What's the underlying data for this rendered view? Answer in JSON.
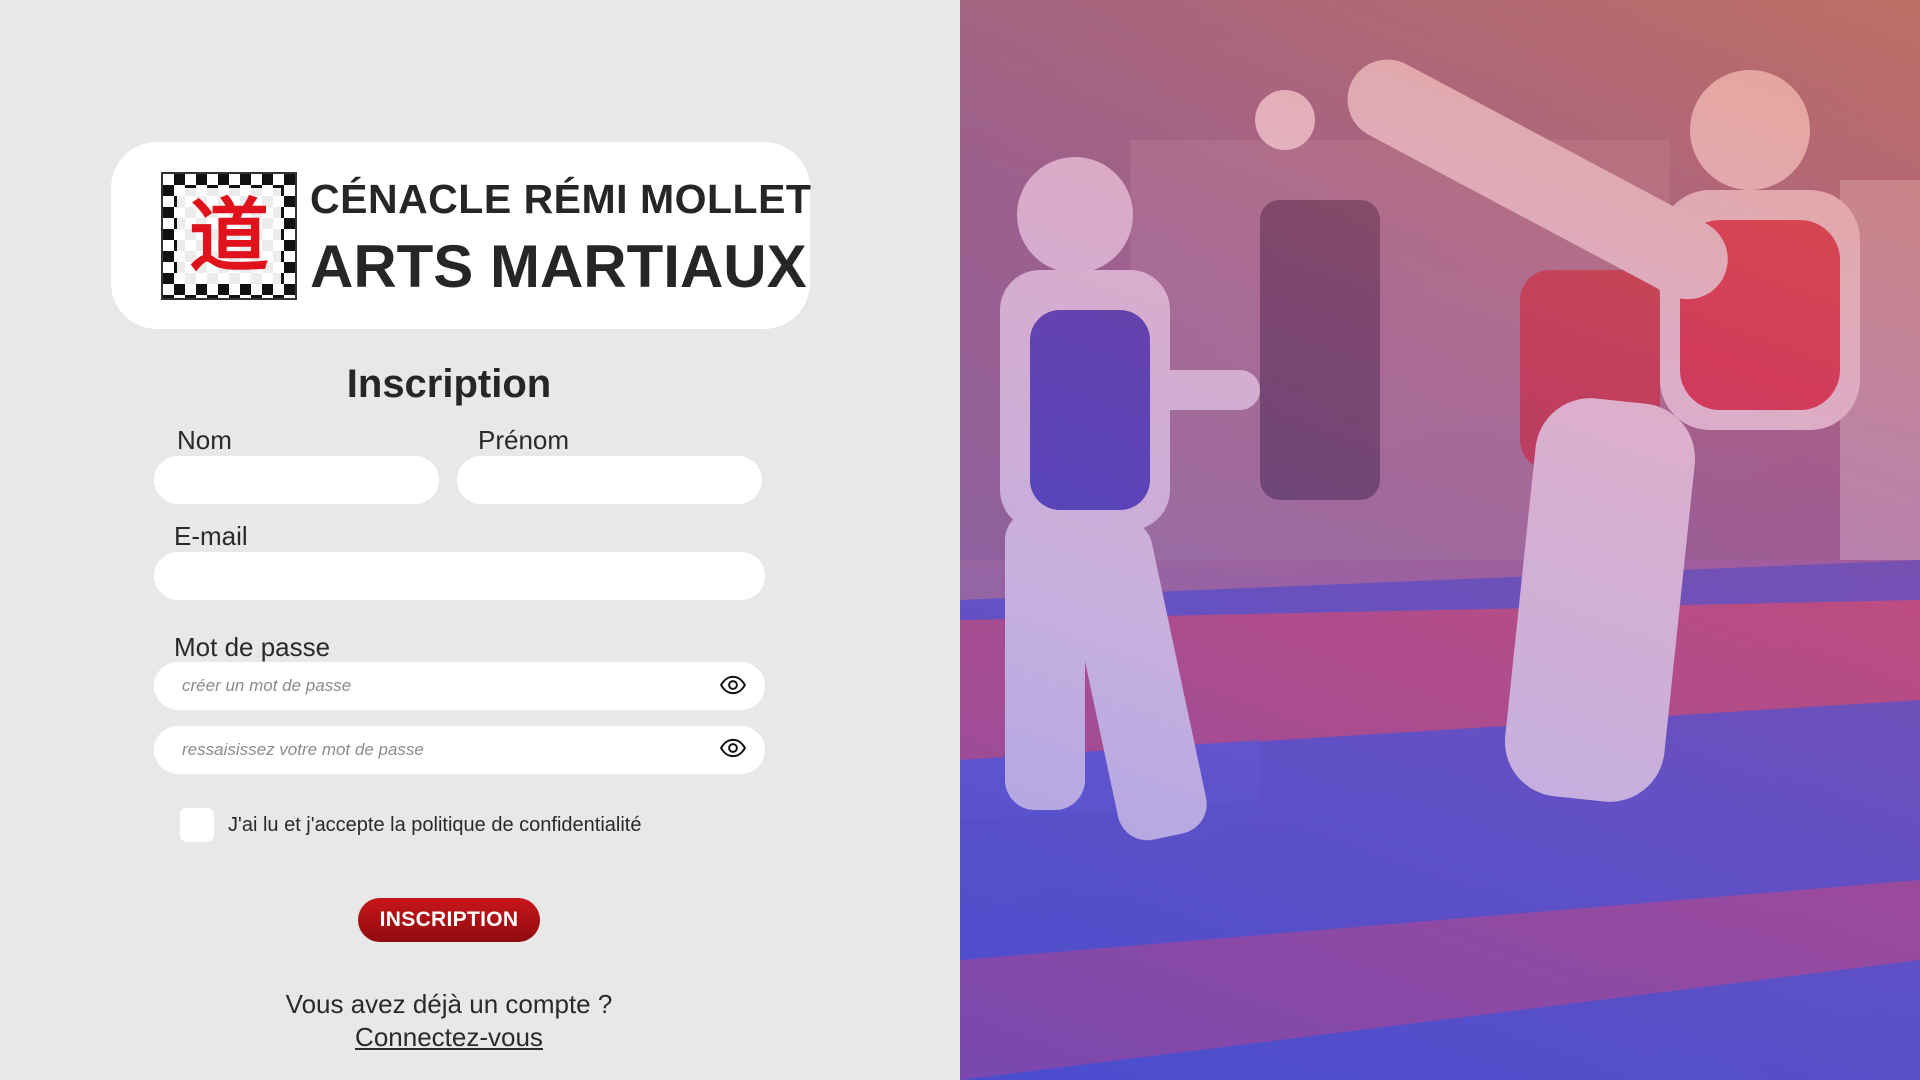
{
  "brand": {
    "line1": "CÉNACLE RÉMI MOLLET",
    "line2": "ARTS MARTIAUX",
    "logo_glyph": "道"
  },
  "form": {
    "title": "Inscription",
    "nom_label": "Nom",
    "prenom_label": "Prénom",
    "email_label": "E-mail",
    "password_label": "Mot de passe",
    "password_placeholder": "créer un mot de passe",
    "password_confirm_placeholder": "ressaisissez votre mot de passe",
    "consent_label": "J'ai lu et j'accepte la politique de confidentialité",
    "submit_label": "INSCRIPTION"
  },
  "footer": {
    "already_text": "Vous avez déjà un compte ?",
    "login_link": "Connectez-vous"
  },
  "hero": {
    "icon": "taekwondo-sparring-photo"
  },
  "colors": {
    "background": "#e8e8e9",
    "card": "#ffffff",
    "button": "#b01217",
    "text": "#2a2a2a"
  }
}
